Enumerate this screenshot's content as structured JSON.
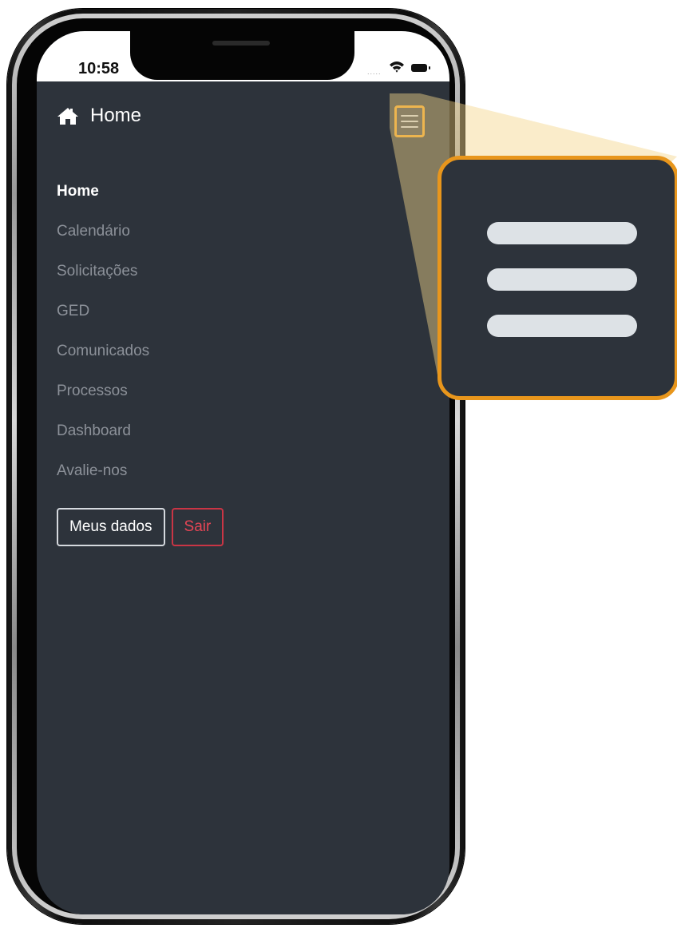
{
  "status_bar": {
    "time": "10:58",
    "signal": "....."
  },
  "navbar": {
    "brand_icon": "home-icon",
    "brand_label": "Home",
    "toggler_icon": "hamburger-menu-icon"
  },
  "menu": {
    "items": [
      {
        "label": "Home",
        "active": true
      },
      {
        "label": "Calendário",
        "active": false
      },
      {
        "label": "Solicitações",
        "active": false
      },
      {
        "label": "GED",
        "active": false
      },
      {
        "label": "Comunicados",
        "active": false
      },
      {
        "label": "Processos",
        "active": false
      },
      {
        "label": "Dashboard",
        "active": false
      },
      {
        "label": "Avalie-nos",
        "active": false
      }
    ]
  },
  "actions": {
    "profile_label": "Meus dados",
    "logout_label": "Sair"
  },
  "colors": {
    "app_background": "#2d333b",
    "highlight": "#e8961c",
    "danger": "#e64555",
    "muted_text": "#8c9199"
  }
}
